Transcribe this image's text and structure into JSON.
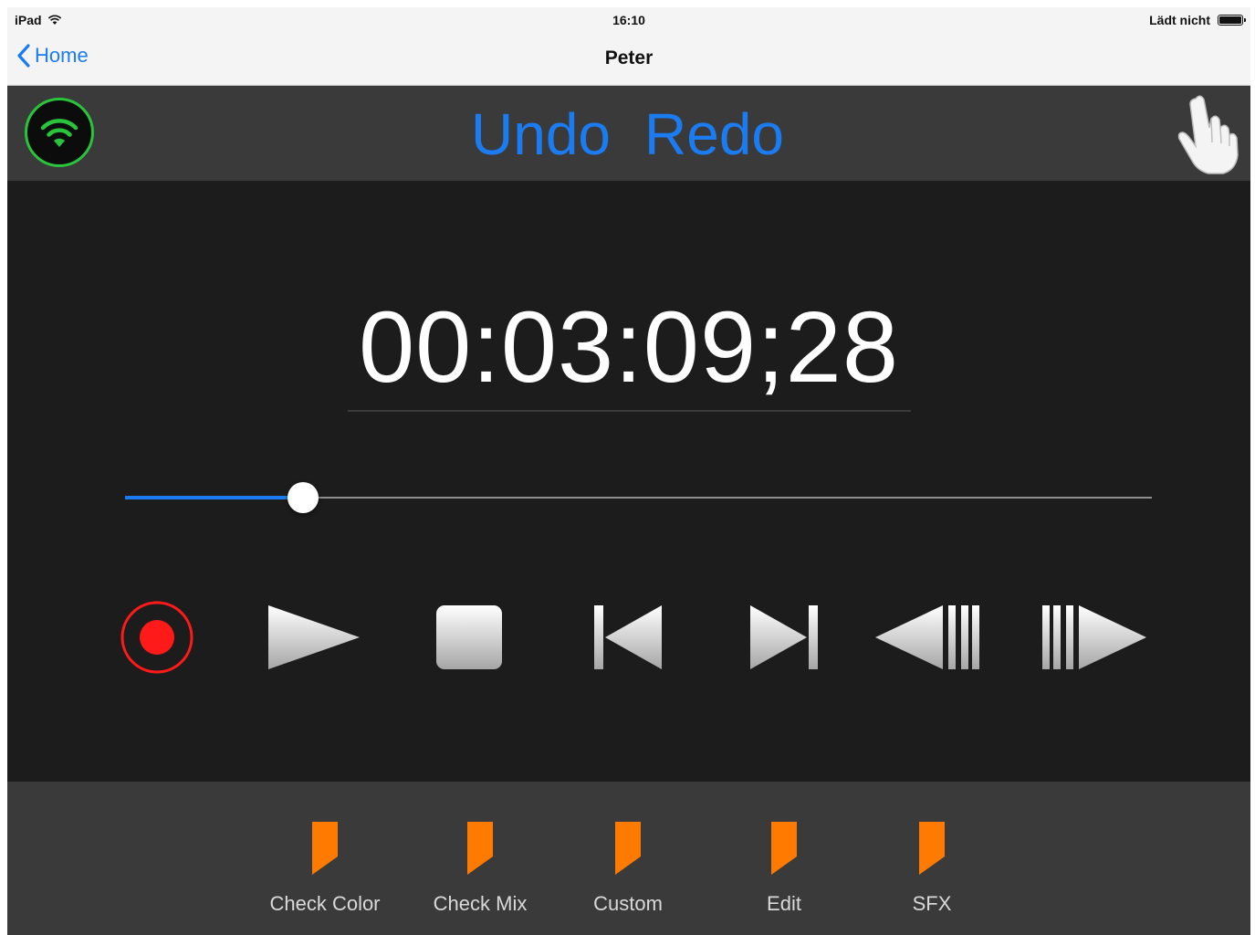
{
  "status_bar": {
    "device": "iPad",
    "time": "16:10",
    "battery_status": "Lädt nicht"
  },
  "nav": {
    "back_label": "Home",
    "title": "Peter"
  },
  "toolbar": {
    "undo_label": "Undo",
    "redo_label": "Redo"
  },
  "player": {
    "timecode": "00:03:09;28",
    "position_fraction": 0.173,
    "transport": [
      "record",
      "play",
      "stop",
      "previous",
      "next",
      "step-back",
      "step-forward"
    ]
  },
  "markers": [
    {
      "label": "Check Color"
    },
    {
      "label": "Check Mix"
    },
    {
      "label": "Custom"
    },
    {
      "label": "Edit"
    },
    {
      "label": "SFX"
    }
  ],
  "colors": {
    "accent": "#1b7cf2",
    "connected": "#29c43c",
    "record": "#ff1a1a",
    "marker": "#ff7a00",
    "background": "#1c1c1c",
    "bars": "#3a3a3a"
  }
}
